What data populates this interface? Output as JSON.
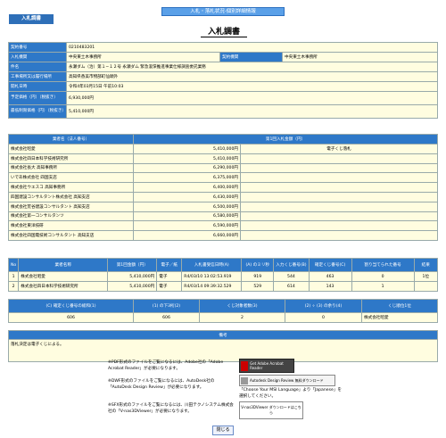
{
  "header": {
    "breadcrumb": "入札・落札状況-個別詳細情報",
    "tag": "入札調書",
    "title": "入札調書"
  },
  "info": {
    "rows": [
      {
        "label": "契約番号",
        "value": "0210483201"
      },
      {
        "label": "入札機関",
        "value": "中央東土木事務所",
        "label2": "契約機関",
        "value2": "中央東土木事務所"
      },
      {
        "label": "件名",
        "value": "永瀬ダム（治）第１−１２号 永瀬ダム 緊急浚渫推進事業仕様調査委託業務"
      },
      {
        "label": "工事場所又は履行場所",
        "value": "高知県香美市物部町仙頭外"
      },
      {
        "label": "開札日時",
        "value": "令和4年03月15日 午前10:03"
      },
      {
        "label": "予定価格（円）（税抜き）",
        "value": "6,930,000円"
      },
      {
        "label": "最低制限価格（円）（税抜き）",
        "value": "5,410,000円"
      }
    ]
  },
  "bidders": {
    "col1": "業者名（法人番号）",
    "col2": "第1回入札金額（円）",
    "rows": [
      {
        "name": "株式会社昭愛",
        "amount": "5,410,000円",
        "note": "電子くじ落札"
      },
      {
        "name": "株式会社四日本科学技術研究所",
        "amount": "5,410,000円",
        "note": ""
      },
      {
        "name": "株式会社長大 高知事務所",
        "amount": "6,290,000円",
        "note": ""
      },
      {
        "name": "いであ株式会社 四国支店",
        "amount": "6,375,000円",
        "note": ""
      },
      {
        "name": "株式会社ウエスコ 高知事務所",
        "amount": "6,400,000円",
        "note": ""
      },
      {
        "name": "四国建設コンサルタント株式会社 高知支店",
        "amount": "6,430,000円",
        "note": ""
      },
      {
        "name": "株式会社荒谷建設コンサルタント 高知支店",
        "amount": "6,500,000円",
        "note": ""
      },
      {
        "name": "株式会社第一コンサルタンツ",
        "amount": "6,580,000円",
        "note": ""
      },
      {
        "name": "株式会社東洋技研",
        "amount": "6,590,000円",
        "note": ""
      },
      {
        "name": "株式会社四国電技術コンサルタント 高知支店",
        "amount": "6,660,000円",
        "note": ""
      }
    ]
  },
  "lottery": {
    "headers": [
      "No",
      "業者名称",
      "第1回金額（円）",
      "電子／紙",
      "入札書受信日時(A)",
      "(A) のミリ秒",
      "入力くじ番号(B)",
      "確定くじ番号(C)",
      "割り当てられた番号",
      "結果"
    ],
    "rows": [
      [
        "1",
        "株式会社昭愛",
        "5,410,000円",
        "電子",
        "R4/03/10 13:02:53.919",
        "919",
        "544",
        "463",
        "0",
        "1位"
      ],
      [
        "2",
        "株式会社四日本科学技術研究所",
        "5,410,000円",
        "電子",
        "R4/03/14 09:39:32.529",
        "529",
        "614",
        "143",
        "1",
        ""
      ]
    ]
  },
  "calc": {
    "headers": [
      "(C) 確定くじ番号の総和(1)",
      "(1) の下3桁(2)",
      "くじ対象者数(3)",
      "(2) ÷ (3) の余り(4)",
      "くじ順位1位"
    ],
    "values": [
      "606",
      "606",
      "2",
      "0",
      "株式会社昭愛"
    ]
  },
  "remarks": {
    "header": "備考",
    "text": "落札決定は電子くじによる。"
  },
  "notes": {
    "pdf": "※PDF形式のファイルをご覧になるには、Adobe社の「Adobe Acrobat Reader」が必要になります。",
    "dwf": "※DWF形式のファイルをご覧になるには、AutoDesk社の「AutoDesk Design Review」が必要になります。",
    "sfx": "※SFX形式のファイルをご覧になるには、川田テクノシステム株式会社の「V-nas3DViewer」が必要になります。",
    "msi": "「Choose Your MSI Language」より「Japanese」を選択してください。",
    "adobe_badge": "Get Adobe Acrobat Reader",
    "autodesk_badge": "Autodesk Design Review 無料ダウンロード",
    "vnas_badge": "V-nas3DViewer ダウンロードはこちら"
  },
  "close_label": "閉じる"
}
